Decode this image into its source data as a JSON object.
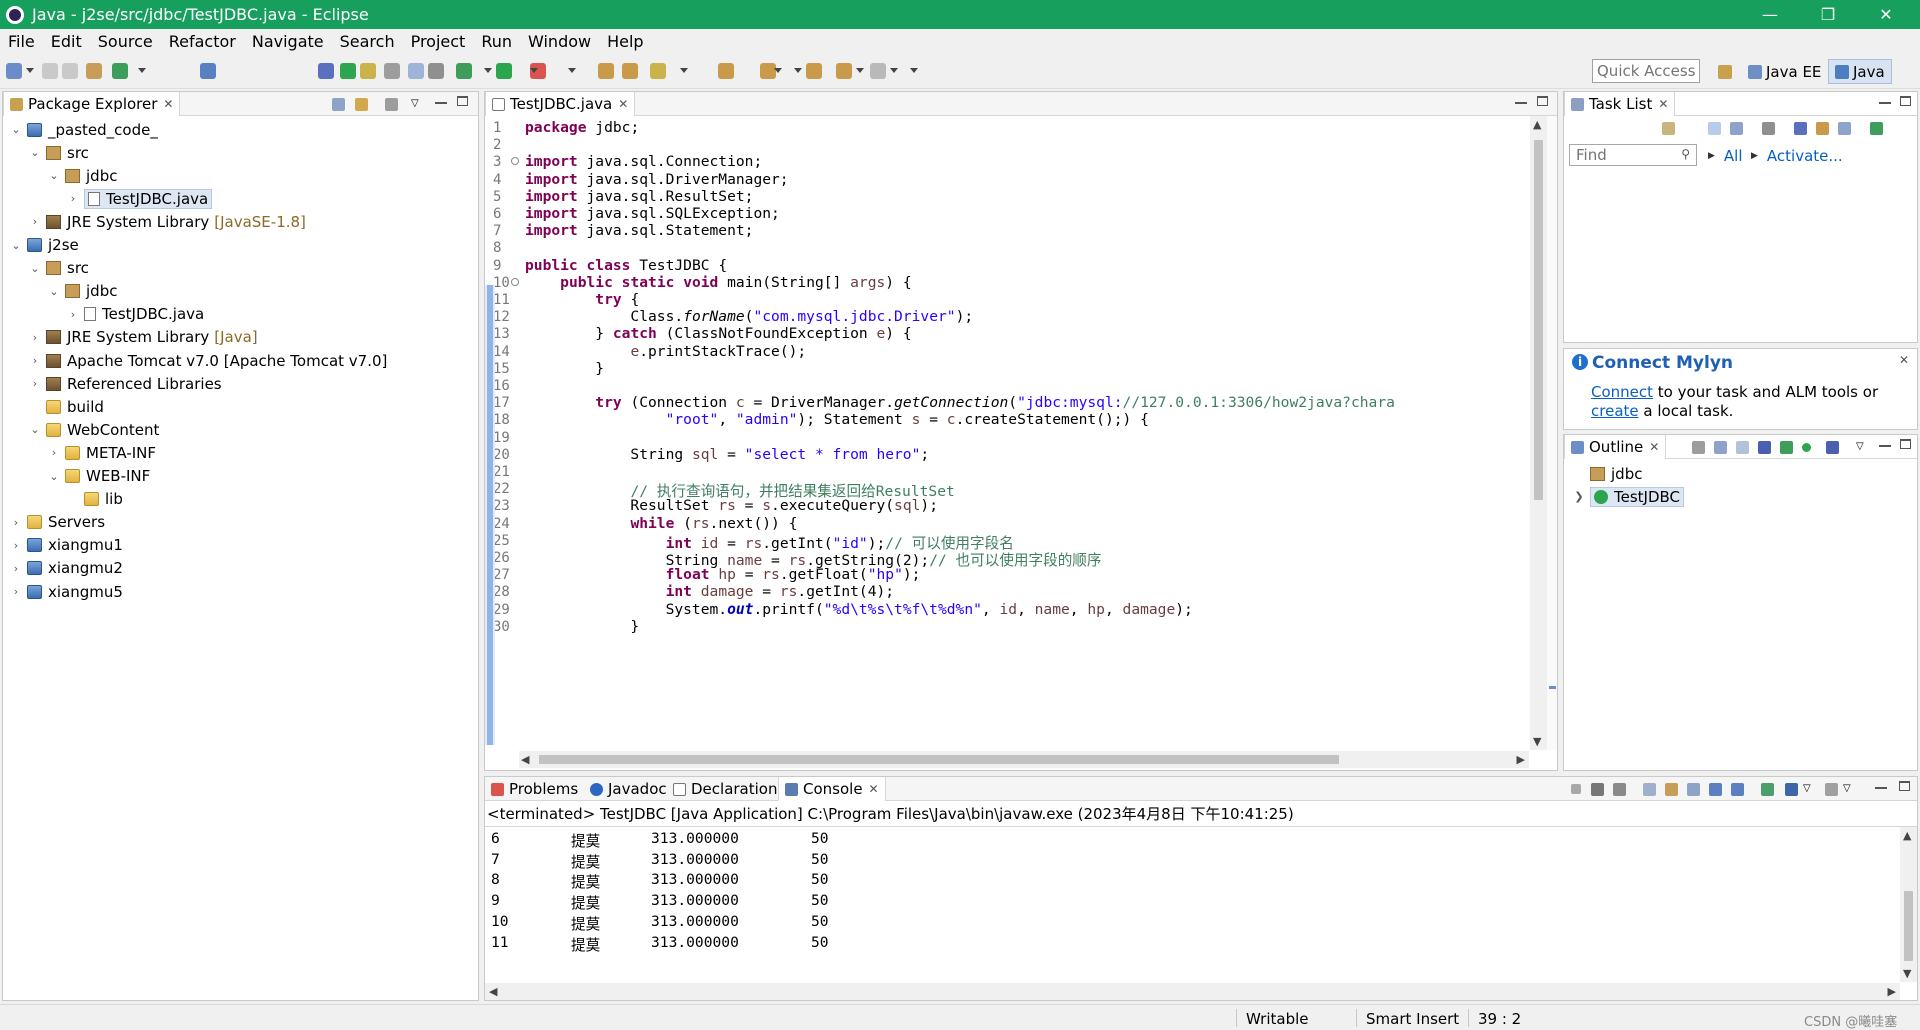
{
  "window": {
    "title": "Java - j2se/src/jdbc/TestJDBC.java - Eclipse"
  },
  "menu": [
    "File",
    "Edit",
    "Source",
    "Refactor",
    "Navigate",
    "Search",
    "Project",
    "Run",
    "Window",
    "Help"
  ],
  "toolbar": {
    "quick_access": "Quick Access",
    "perspectives": [
      "Java EE",
      "Java"
    ]
  },
  "package_explorer": {
    "tab_label": "Package Explorer",
    "tree": [
      {
        "label": "_pasted_code_",
        "kind": "project",
        "depth": 0,
        "expanded": true
      },
      {
        "label": "src",
        "kind": "srcfolder",
        "depth": 1,
        "expanded": true
      },
      {
        "label": "jdbc",
        "kind": "package",
        "depth": 2,
        "expanded": true
      },
      {
        "label": "TestJDBC.java",
        "kind": "file",
        "depth": 3,
        "expanded": false,
        "selected": true
      },
      {
        "label": "JRE System Library",
        "decoration": "[JavaSE-1.8]",
        "kind": "lib",
        "depth": 1,
        "expanded": false
      },
      {
        "label": "j2se",
        "kind": "project",
        "depth": 0,
        "expanded": true
      },
      {
        "label": "src",
        "kind": "srcfolder",
        "depth": 1,
        "expanded": true
      },
      {
        "label": "jdbc",
        "kind": "package",
        "depth": 2,
        "expanded": true
      },
      {
        "label": "TestJDBC.java",
        "kind": "file",
        "depth": 3,
        "expanded": false
      },
      {
        "label": "JRE System Library",
        "decoration": "[Java]",
        "kind": "lib",
        "depth": 1,
        "expanded": false
      },
      {
        "label": "Apache Tomcat v7.0 [Apache Tomcat v7.0]",
        "kind": "lib",
        "depth": 1,
        "expanded": false
      },
      {
        "label": "Referenced Libraries",
        "kind": "lib",
        "depth": 1,
        "expanded": false
      },
      {
        "label": "build",
        "kind": "folder",
        "depth": 1,
        "expanded": null
      },
      {
        "label": "WebContent",
        "kind": "folder",
        "depth": 1,
        "expanded": true
      },
      {
        "label": "META-INF",
        "kind": "folder",
        "depth": 2,
        "expanded": false
      },
      {
        "label": "WEB-INF",
        "kind": "folder",
        "depth": 2,
        "expanded": true
      },
      {
        "label": "lib",
        "kind": "folder",
        "depth": 3,
        "expanded": null
      },
      {
        "label": "Servers",
        "kind": "folder",
        "depth": 0,
        "expanded": false
      },
      {
        "label": "xiangmu1",
        "kind": "project",
        "depth": 0,
        "expanded": false
      },
      {
        "label": "xiangmu2",
        "kind": "project",
        "depth": 0,
        "expanded": false
      },
      {
        "label": "xiangmu5",
        "kind": "project",
        "depth": 0,
        "expanded": false
      }
    ]
  },
  "editor": {
    "tab_label": "TestJDBC.java",
    "lines": [
      "package jdbc;",
      "",
      "import java.sql.Connection;",
      "import java.sql.DriverManager;",
      "import java.sql.ResultSet;",
      "import java.sql.SQLException;",
      "import java.sql.Statement;",
      "",
      "public class TestJDBC {",
      "    public static void main(String[] args) {",
      "        try {",
      "            Class.forName(\"com.mysql.jdbc.Driver\");",
      "        } catch (ClassNotFoundException e) {",
      "            e.printStackTrace();",
      "        }",
      "",
      "        try (Connection c = DriverManager.getConnection(\"jdbc:mysql://127.0.0.1:3306/how2java?chara",
      "                \"root\", \"admin\"); Statement s = c.createStatement();) {",
      "",
      "            String sql = \"select * from hero\";",
      "",
      "            // 执行查询语句，并把结果集返回给ResultSet",
      "            ResultSet rs = s.executeQuery(sql);",
      "            while (rs.next()) {",
      "                int id = rs.getInt(\"id\");// 可以使用字段名",
      "                String name = rs.getString(2);// 也可以使用字段的顺序",
      "                float hp = rs.getFloat(\"hp\");",
      "                int damage = rs.getInt(4);",
      "                System.out.printf(\"%d\\t%s\\t%f\\t%d%n\", id, name, hp, damage);",
      "            }"
    ]
  },
  "task_list": {
    "tab_label": "Task List",
    "find_placeholder": "Find",
    "all_label": "All",
    "activate_label": "Activate..."
  },
  "mylyn": {
    "title": "Connect Mylyn",
    "connect_link": "Connect",
    "text1": " to your task and ALM tools or",
    "create_link": "create",
    "text2": " a local task."
  },
  "outline": {
    "tab_label": "Outline",
    "items": [
      "jdbc",
      "TestJDBC"
    ]
  },
  "bottom_tabs": [
    "Problems",
    "Javadoc",
    "Declaration",
    "Console"
  ],
  "console": {
    "header": "<terminated> TestJDBC [Java Application] C:\\Program Files\\Java\\bin\\javaw.exe (2023年4月8日 下午10:41:25)",
    "rows": [
      {
        "id": "6",
        "name": "提莫",
        "hp": "313.000000",
        "damage": "50"
      },
      {
        "id": "7",
        "name": "提莫",
        "hp": "313.000000",
        "damage": "50"
      },
      {
        "id": "8",
        "name": "提莫",
        "hp": "313.000000",
        "damage": "50"
      },
      {
        "id": "9",
        "name": "提莫",
        "hp": "313.000000",
        "damage": "50"
      },
      {
        "id": "10",
        "name": "提莫",
        "hp": "313.000000",
        "damage": "50"
      },
      {
        "id": "11",
        "name": "提莫",
        "hp": "313.000000",
        "damage": "50"
      }
    ]
  },
  "status": {
    "writable": "Writable",
    "insert_mode": "Smart Insert",
    "position": "39 : 2",
    "watermark": "CSDN @曦哇塞"
  }
}
